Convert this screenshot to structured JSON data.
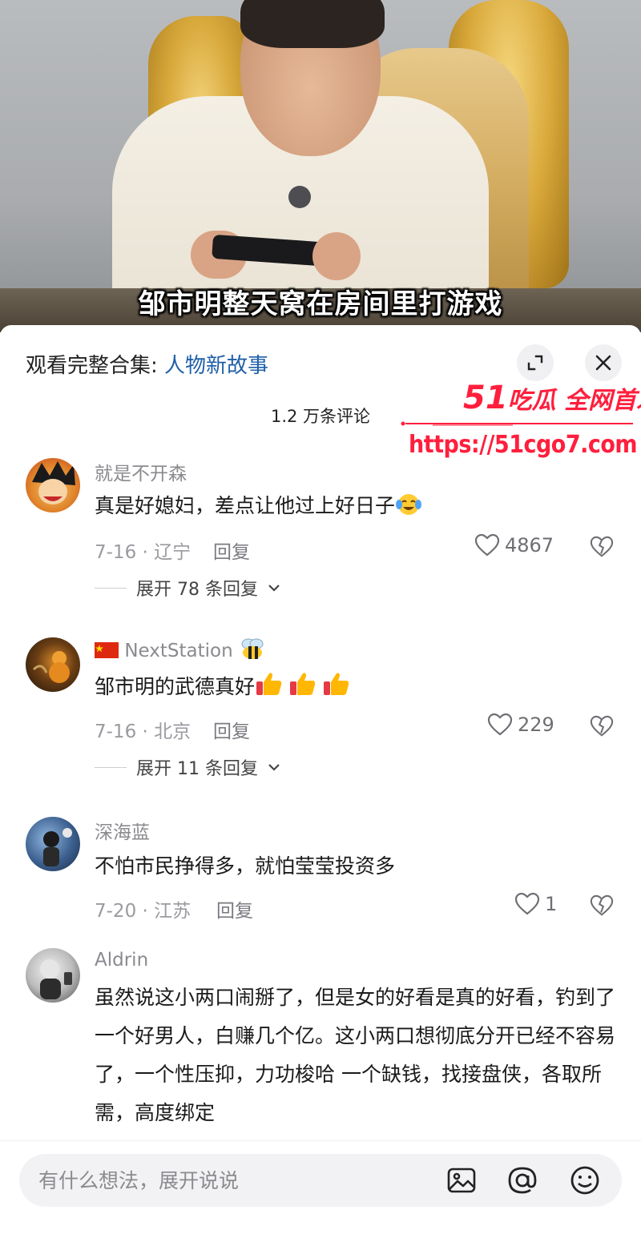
{
  "video": {
    "subtitle": "邹市明整天窝在房间里打游戏"
  },
  "panel": {
    "collection_prefix": "观看完整合集: ",
    "collection_link": "人物新故事",
    "comment_count": "1.2 万条评论"
  },
  "watermark": {
    "brand_num": "51",
    "brand_text": "吃瓜 全网首发",
    "url": "https://51cgo7.com"
  },
  "comments": [
    {
      "user": "就是不开森",
      "text": "真是好媳妇，差点让他过上好日子",
      "date_loc": "7-16 · 辽宁",
      "reply": "回复",
      "likes": "4867",
      "expand": "展开 78 条回复"
    },
    {
      "user": "NextStation",
      "text": "邹市明的武德真好",
      "date_loc": "7-16 · 北京",
      "reply": "回复",
      "likes": "229",
      "expand": "展开 11 条回复"
    },
    {
      "user": "深海蓝",
      "text": "不怕市民挣得多，就怕莹莹投资多",
      "date_loc": "7-20 · 江苏",
      "reply": "回复",
      "likes": "1"
    },
    {
      "user": "Aldrin",
      "text": "虽然说这小两口闹掰了，但是女的好看是真的好看，钓到了一个好男人，白赚几个亿。这小两口想彻底分开已经不容易了，一个性压抑，力功梭哈 一个缺钱，找接盘侠，各取所需，高度绑定"
    }
  ],
  "input": {
    "placeholder": "有什么想法，展开说说"
  },
  "icons": {
    "expand": "expand-icon",
    "close": "close-icon",
    "like": "heart-icon",
    "dislike": "broken-heart-icon",
    "image": "image-icon",
    "mention": "at-icon",
    "emoji": "smile-icon"
  },
  "colors": {
    "link": "#1f5fa8",
    "watermark": "#ff1f3d"
  }
}
